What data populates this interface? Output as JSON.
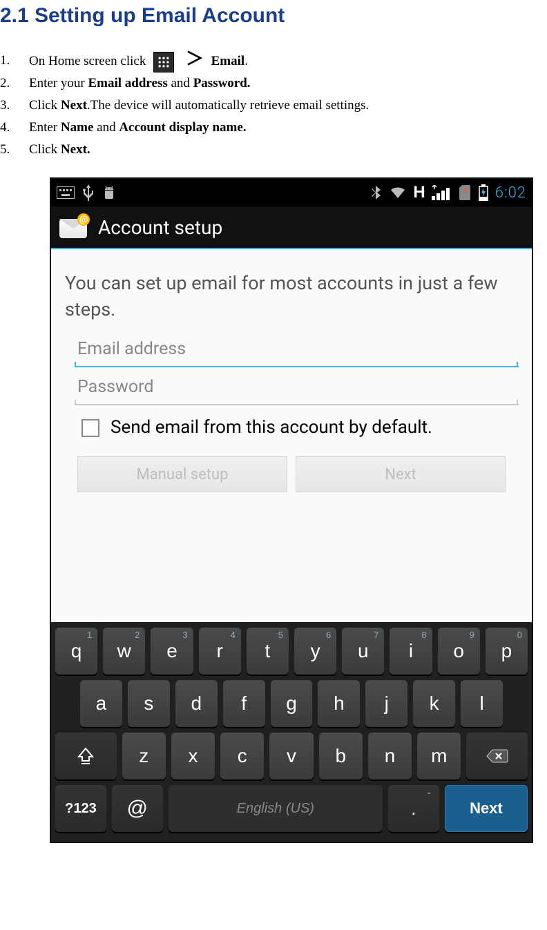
{
  "doc": {
    "heading": "2.1 Setting up Email Account",
    "steps": {
      "s1_num": "1.",
      "s1_a": "On Home screen click ",
      "s1_b": "Email",
      "s2_num": "2.",
      "s2_a": "Enter your ",
      "s2_b": "Email address",
      "s2_c": " and ",
      "s2_d": "Password.",
      "s3_num": "3.",
      "s3_a": "Click ",
      "s3_b": "Next",
      "s3_c": ".The device will automatically retrieve email settings.",
      "s4_num": "4.",
      "s4_a": "Enter ",
      "s4_b": "Name",
      "s4_c": " and ",
      "s4_d": "Account display name.",
      "s5_num": "5.",
      "s5_a": "Click ",
      "s5_b": "Next."
    }
  },
  "statusbar": {
    "network_label": "H",
    "time": "6:02"
  },
  "app": {
    "header_title": "Account setup",
    "setup_message": "You can set up email for most accounts in just a few steps.",
    "email_placeholder": "Email address",
    "password_placeholder": "Password",
    "default_checkbox_label": "Send email from this account by default.",
    "btn_manual": "Manual setup",
    "btn_next": "Next"
  },
  "keyboard": {
    "row1": [
      {
        "main": "q",
        "hint": "1"
      },
      {
        "main": "w",
        "hint": "2"
      },
      {
        "main": "e",
        "hint": "3"
      },
      {
        "main": "r",
        "hint": "4"
      },
      {
        "main": "t",
        "hint": "5"
      },
      {
        "main": "y",
        "hint": "6"
      },
      {
        "main": "u",
        "hint": "7"
      },
      {
        "main": "i",
        "hint": "8"
      },
      {
        "main": "o",
        "hint": "9"
      },
      {
        "main": "p",
        "hint": "0"
      }
    ],
    "row2": [
      {
        "main": "a"
      },
      {
        "main": "s"
      },
      {
        "main": "d"
      },
      {
        "main": "f"
      },
      {
        "main": "g"
      },
      {
        "main": "h"
      },
      {
        "main": "j"
      },
      {
        "main": "k"
      },
      {
        "main": "l"
      }
    ],
    "row3": [
      {
        "main": "z"
      },
      {
        "main": "x"
      },
      {
        "main": "c"
      },
      {
        "main": "v"
      },
      {
        "main": "b"
      },
      {
        "main": "n"
      },
      {
        "main": "m"
      }
    ],
    "sym_label": "?123",
    "at_label": "@",
    "space_label": "English (US)",
    "dot_label": ".",
    "dot_hint": "-",
    "next_label": "Next"
  }
}
